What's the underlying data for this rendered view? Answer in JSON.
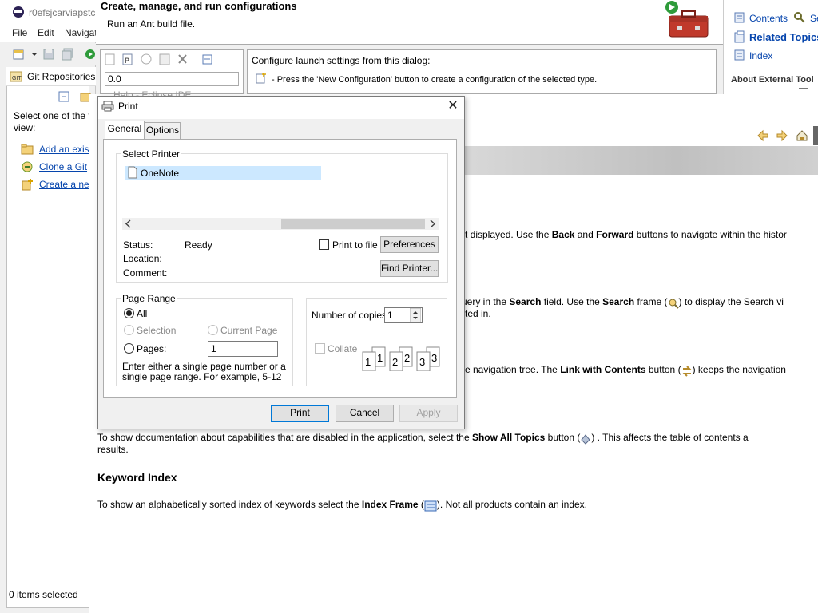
{
  "eclipse": {
    "window_title": "r0efsjcarviapstc",
    "menu": [
      "File",
      "Edit",
      "Navigat"
    ],
    "git_view_title": "Git Repositories",
    "git_desc": "Select one of the f view:",
    "git_links": [
      "Add an exist",
      "Clone a Git",
      "Create a new"
    ],
    "status": "0 items selected"
  },
  "run_config": {
    "title": "Create, manage, and run configurations",
    "subtitle": "Run an Ant build file.",
    "filter_value": "0.0",
    "msg1": "Configure launch settings from this dialog:",
    "msg2": "- Press the 'New Configuration' button to create a configuration of the selected type."
  },
  "help_sidebar": {
    "items": [
      "Contents",
      "Se",
      "Related Topics",
      "Index",
      "About External Tool"
    ]
  },
  "help_window": {
    "title": "Help - Eclipse IDE",
    "para1": {
      "pre": "t displayed. Use the ",
      "b1": "Back",
      "mid": " and ",
      "b2": "Forward",
      "post": " buttons to navigate within the histor"
    },
    "para2": {
      "pre": "uery in the ",
      "b1": "Search",
      "mid": " field. Use the ",
      "b2": "Search",
      "post": " frame (",
      "post2": ") to display the Search vi",
      "line2": "ted in."
    },
    "para3": {
      "pre": "e navigation tree. The ",
      "b1": "Link with Contents",
      "mid": " button (",
      "post": ") keeps the navigation"
    },
    "para4": {
      "pre": "To show documentation about capabilities that are disabled in the application, select the ",
      "b1": "Show All Topics",
      "post": " button (",
      "post2": ") . This affects the table of contents a",
      "line2": "results."
    },
    "keyword_heading": "Keyword Index",
    "para5": {
      "pre": "To show an alphabetically sorted index of keywords select the ",
      "b1": "Index Frame",
      "post": " (",
      "post2": "). Not all products contain an index."
    }
  },
  "print_dialog": {
    "title": "Print",
    "close": "✕",
    "tabs": [
      "General",
      "Options"
    ],
    "select_printer_label": "Select Printer",
    "printer": "OneNote",
    "status_label": "Status:",
    "status_value": "Ready",
    "location_label": "Location:",
    "comment_label": "Comment:",
    "print_to_file": "Print to file",
    "preferences_btn": "Preferences",
    "find_printer_btn": "Find Printer...",
    "page_range_label": "Page Range",
    "range_all": "All",
    "range_selection": "Selection",
    "range_current": "Current Page",
    "range_pages": "Pages:",
    "pages_value": "1",
    "range_hint": "Enter either a single page number or a single page range.  For example, 5-12",
    "copies_label": "Number of copies:",
    "copies_value": "1",
    "collate": "Collate",
    "print_btn": "Print",
    "cancel_btn": "Cancel",
    "apply_btn": "Apply",
    "collate_numbers": [
      "1",
      "1",
      "2",
      "2",
      "3",
      "3"
    ]
  },
  "colors": {
    "link": "#0645ad",
    "selection": "#cce8ff",
    "focus_border": "#0078d7"
  }
}
